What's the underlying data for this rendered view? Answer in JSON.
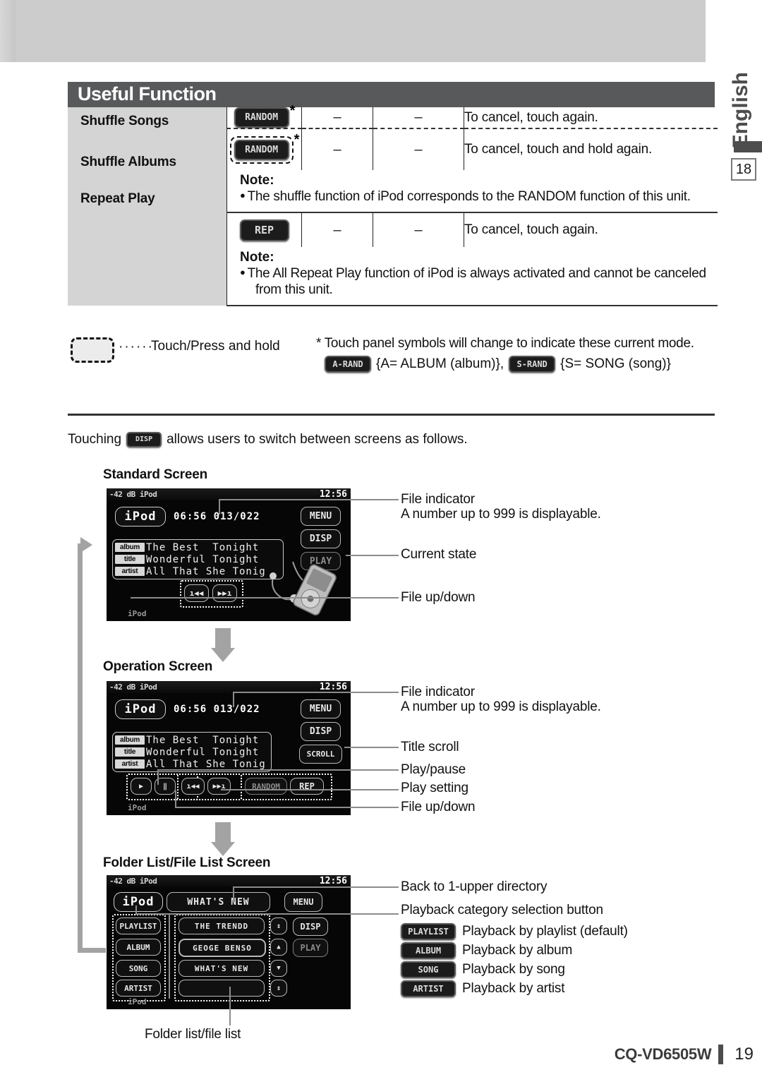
{
  "page": {
    "language_tab": "English",
    "side_page_number": "18",
    "footer_model": "CQ-VD6505W",
    "footer_page": "19"
  },
  "section": {
    "heading": "Useful Function"
  },
  "table": {
    "rows": [
      {
        "name": "Shuffle Songs",
        "button": "RANDOM",
        "star": "*",
        "hold": false,
        "col2": "–",
        "col3": "–",
        "desc": "To cancel, touch again."
      },
      {
        "name": "Shuffle Albums",
        "button": "RANDOM",
        "star": "*",
        "hold": true,
        "col2": "–",
        "col3": "–",
        "desc": "To cancel, touch and hold again."
      }
    ],
    "note1": {
      "heading": "Note:",
      "line": "The shuffle function of iPod corresponds to the RANDOM function of this unit."
    },
    "repeat_row": {
      "name": "Repeat Play",
      "button": "REP",
      "col2": "–",
      "col3": "–",
      "desc": "To cancel, touch again."
    },
    "note2": {
      "heading": "Note:",
      "line1": "The All Repeat Play function of iPod is always activated and cannot be canceled",
      "line2": "from this unit."
    }
  },
  "legend": {
    "dots": "······",
    "hold_text": "Touch/Press and hold",
    "star_note": "* Touch panel symbols will change to indicate these current mode.",
    "arand_button": "A-RAND",
    "arand_text": "{A= ALBUM (album)},",
    "srand_button": "S-RAND",
    "srand_text": "{S= SONG (song)}"
  },
  "touching": {
    "prefix": "Touching",
    "button": "DISP",
    "suffix": "allows users to switch between screens as follows."
  },
  "standard_screen": {
    "title": "Standard Screen",
    "status_left": "-42 dB iPod",
    "clock": "12:56",
    "source_pill": "iPod",
    "time_and_file": "06:56 013/022",
    "menu": "MENU",
    "disp": "DISP",
    "play": "PLAY",
    "bottom_label": "iPod",
    "info": [
      {
        "tag": "album",
        "value": "The Best  Tonight"
      },
      {
        "tag": "title",
        "value": "Wonderful Tonight"
      },
      {
        "tag": "artist",
        "value": "All That She Tonig"
      }
    ],
    "prev": "ı◀◀",
    "next": "▶▶ı",
    "annotations": [
      "File indicator",
      "A number up to 999 is displayable.",
      "Current state",
      "File up/down"
    ]
  },
  "operation_screen": {
    "title": "Operation Screen",
    "status_left": "-42 dB iPod",
    "clock": "12:56",
    "source_pill": "iPod",
    "time_and_file": "06:56 013/022",
    "menu": "MENU",
    "disp": "DISP",
    "scroll": "SCROLL",
    "bottom_label": "iPod",
    "info": [
      {
        "tag": "album",
        "value": "The Best  Tonight"
      },
      {
        "tag": "title",
        "value": "Wonderful Tonight"
      },
      {
        "tag": "artist",
        "value": "All That She Tonig"
      }
    ],
    "play_btn": "▶",
    "pause_btn": "‖",
    "prev": "ı◀◀",
    "next": "▶▶ı",
    "random": "RANDOM",
    "rep": "REP",
    "annotations": [
      "File indicator",
      "A number up to 999 is displayable.",
      "Title scroll",
      "Play/pause",
      "Play setting",
      "File up/down"
    ]
  },
  "folder_screen": {
    "title": "Folder List/File List Screen",
    "status_left": "-42 dB iPod",
    "clock": "12:56",
    "source_pill": "iPod",
    "header_title": "WHAT'S NEW",
    "menu": "MENU",
    "disp": "DISP",
    "play": "PLAY",
    "bottom_label": "iPod",
    "categories": [
      "PLAYLIST",
      "ALBUM",
      "SONG",
      "ARTIST"
    ],
    "files": [
      "THE TRENDD",
      "GEOGE BENSO",
      "WHAT'S NEW",
      ""
    ],
    "scroll_icons": [
      "↕",
      "▲",
      "▼",
      "↕"
    ],
    "annotations": [
      "Back to 1-upper directory",
      "Playback category selection button"
    ],
    "caption": "Folder list/file list",
    "category_legend": [
      {
        "button": "PLAYLIST",
        "label": "Playback by playlist (default)"
      },
      {
        "button": "ALBUM",
        "label": "Playback by album"
      },
      {
        "button": "SONG",
        "label": "Playback by song"
      },
      {
        "button": "ARTIST",
        "label": "Playback by artist"
      }
    ]
  }
}
